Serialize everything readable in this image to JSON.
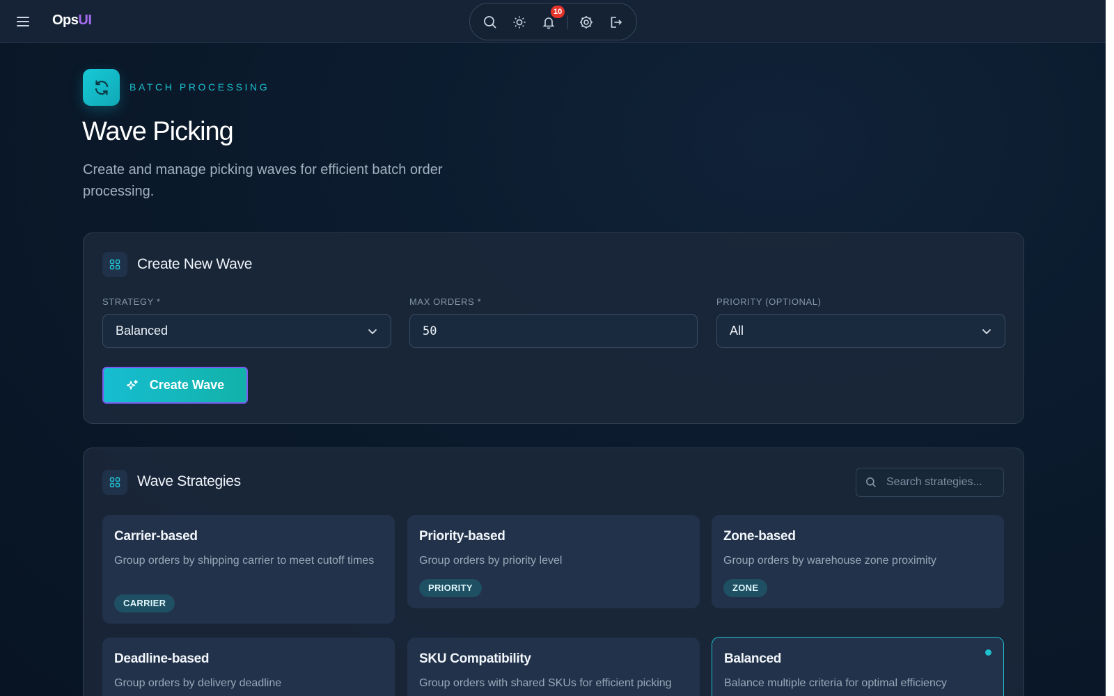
{
  "app": {
    "brand_part1": "Ops",
    "brand_part2": "UI",
    "notification_count": "10"
  },
  "toolbar": {
    "icons": [
      "search-icon",
      "sun-icon",
      "bell-icon",
      "gear-icon",
      "logout-icon"
    ]
  },
  "header": {
    "eyebrow": "BATCH PROCESSING",
    "title": "Wave Picking",
    "subtitle": "Create and manage picking waves for efficient batch order processing."
  },
  "create_panel": {
    "title": "Create New Wave",
    "strategy_label": "STRATEGY *",
    "strategy_value": "Balanced",
    "max_orders_label": "MAX ORDERS *",
    "max_orders_value": "50",
    "priority_label": "PRIORITY (OPTIONAL)",
    "priority_value": "All",
    "button_label": "Create Wave"
  },
  "strategies_panel": {
    "title": "Wave Strategies",
    "search_placeholder": "Search strategies...",
    "cards": [
      {
        "title": "Carrier-based",
        "description": "Group orders by shipping carrier to meet cutoff times",
        "tag": "CARRIER",
        "selected": false
      },
      {
        "title": "Priority-based",
        "description": "Group orders by priority level",
        "tag": "PRIORITY",
        "selected": false
      },
      {
        "title": "Zone-based",
        "description": "Group orders by warehouse zone proximity",
        "tag": "ZONE",
        "selected": false
      },
      {
        "title": "Deadline-based",
        "description": "Group orders by delivery deadline",
        "tag": "",
        "selected": false
      },
      {
        "title": "SKU Compatibility",
        "description": "Group orders with shared SKUs for efficient picking",
        "tag": "",
        "selected": false
      },
      {
        "title": "Balanced",
        "description": "Balance multiple criteria for optimal efficiency",
        "tag": "",
        "selected": true
      }
    ]
  },
  "colors": {
    "accent": "#1ec1cf",
    "brand_accent": "#a66cf0",
    "badge": "#e5342c",
    "button_border": "#7b5cf0"
  }
}
